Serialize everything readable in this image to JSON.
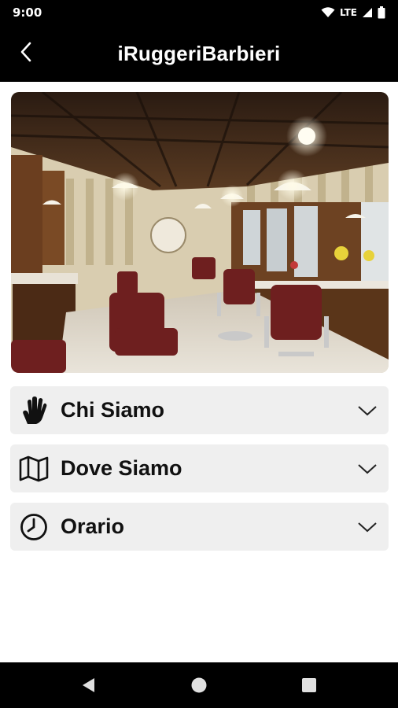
{
  "status_bar": {
    "time": "9:00",
    "network": "LTE",
    "icons": [
      "wifi-icon",
      "cellular-signal-icon",
      "battery-icon"
    ]
  },
  "app_bar": {
    "title": "iRuggeriBarbieri",
    "back_icon": "chevron-left-icon"
  },
  "hero_image": {
    "subject": "barbershop interior"
  },
  "sections": [
    {
      "label": "Chi Siamo",
      "icon": "hand-icon",
      "chevron": "chevron-down-icon"
    },
    {
      "label": "Dove Siamo",
      "icon": "map-icon",
      "chevron": "chevron-down-icon"
    },
    {
      "label": "Orario",
      "icon": "clock-icon",
      "chevron": "chevron-down-icon"
    }
  ],
  "nav_bar": {
    "buttons": [
      "back-triangle-icon",
      "home-circle-icon",
      "recents-square-icon"
    ]
  },
  "colors": {
    "bars": "#000000",
    "accordion_bg": "#efefef",
    "text": "#111111"
  }
}
